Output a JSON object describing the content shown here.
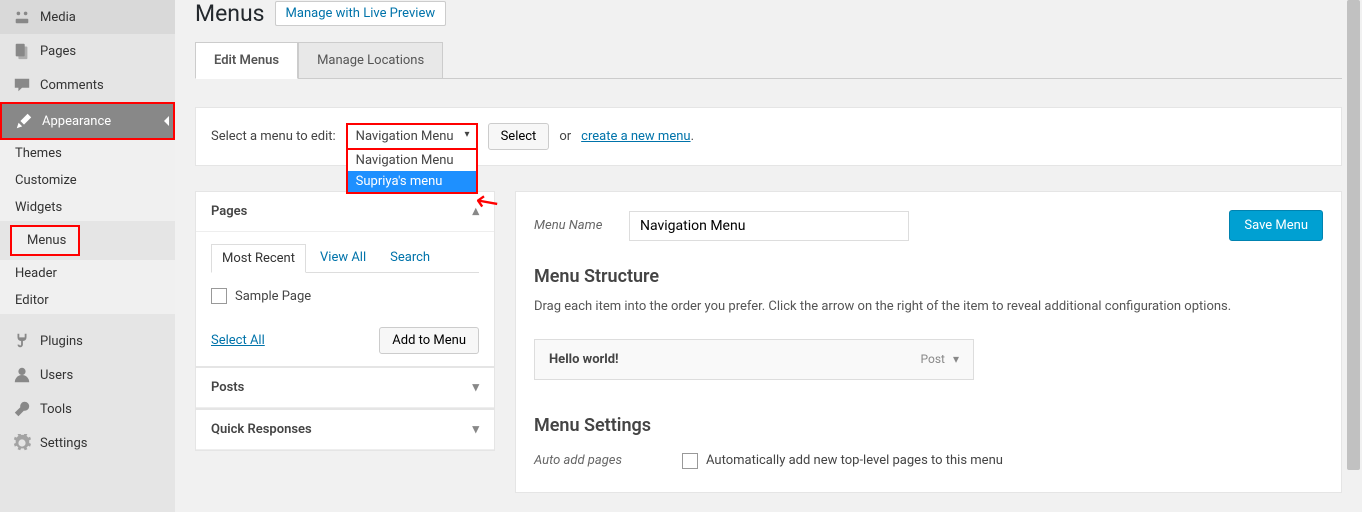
{
  "sidebar": {
    "items": [
      {
        "label": "Media",
        "icon": "media"
      },
      {
        "label": "Pages",
        "icon": "page"
      },
      {
        "label": "Comments",
        "icon": "comment"
      },
      {
        "label": "Appearance",
        "icon": "brush",
        "active": true
      },
      {
        "label": "Plugins",
        "icon": "plug"
      },
      {
        "label": "Users",
        "icon": "user"
      },
      {
        "label": "Tools",
        "icon": "wrench"
      },
      {
        "label": "Settings",
        "icon": "gear"
      }
    ],
    "subs": [
      "Themes",
      "Customize",
      "Widgets",
      "Menus",
      "Header",
      "Editor"
    ],
    "sub_selected": "Menus"
  },
  "header": {
    "title": "Menus",
    "preview_btn": "Manage with Live Preview"
  },
  "tabs": {
    "edit": "Edit Menus",
    "manage": "Manage Locations"
  },
  "selrow": {
    "label": "Select a menu to edit:",
    "selected": "Navigation Menu",
    "options": [
      "Navigation Menu",
      "Supriya's menu"
    ],
    "select_btn": "Select",
    "or": "or",
    "create_link": "create a new menu",
    "dot": "."
  },
  "left": {
    "pages": {
      "title": "Pages",
      "subtabs": [
        "Most Recent",
        "View All",
        "Search"
      ],
      "items": [
        "Sample Page"
      ],
      "select_all": "Select All",
      "add_btn": "Add to Menu"
    },
    "posts_title": "Posts",
    "quick_title": "Quick Responses"
  },
  "right": {
    "menu_name_label": "Menu Name",
    "menu_name_value": "Navigation Menu",
    "save_btn": "Save Menu",
    "structure_title": "Menu Structure",
    "structure_desc": "Drag each item into the order you prefer. Click the arrow on the right of the item to reveal additional configuration options.",
    "item": {
      "label": "Hello world!",
      "type": "Post"
    },
    "settings_title": "Menu Settings",
    "auto_label": "Auto add pages",
    "auto_desc": "Automatically add new top-level pages to this menu"
  }
}
